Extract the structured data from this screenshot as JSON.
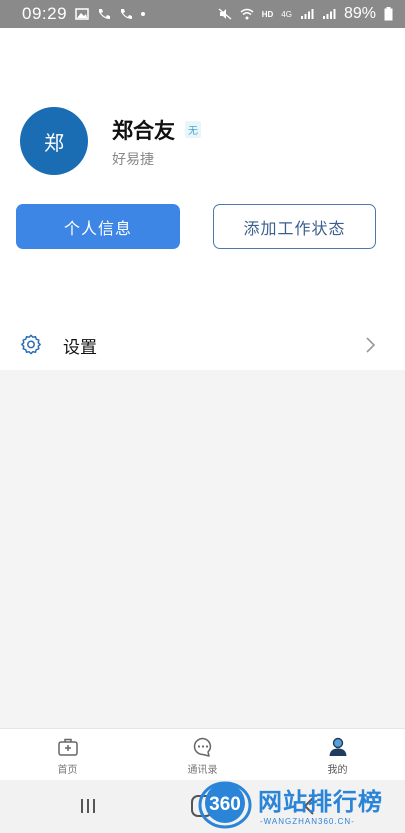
{
  "status_bar": {
    "time": "09:29",
    "battery_percent": "89%",
    "network": "HD",
    "net_type": "4G"
  },
  "profile": {
    "avatar_text": "郑",
    "name": "郑合友",
    "badge": "无",
    "company": "好易捷"
  },
  "actions": {
    "personal_info": "个人信息",
    "add_work_status": "添加工作状态"
  },
  "settings": {
    "label": "设置"
  },
  "tabs": [
    {
      "label": "首页",
      "icon": "briefcase-icon"
    },
    {
      "label": "通讯录",
      "icon": "chat-bubble-icon"
    },
    {
      "label": "我的",
      "icon": "person-icon"
    }
  ],
  "watermark": {
    "logo_text": "360",
    "title": "网站排行榜",
    "subtitle": "-WANGZHAN360.CN-"
  },
  "colors": {
    "primary": "#3d86e6",
    "avatar_bg": "#1a6db3",
    "outline": "#4c78a8",
    "active_tab": "#1e3d5c"
  }
}
